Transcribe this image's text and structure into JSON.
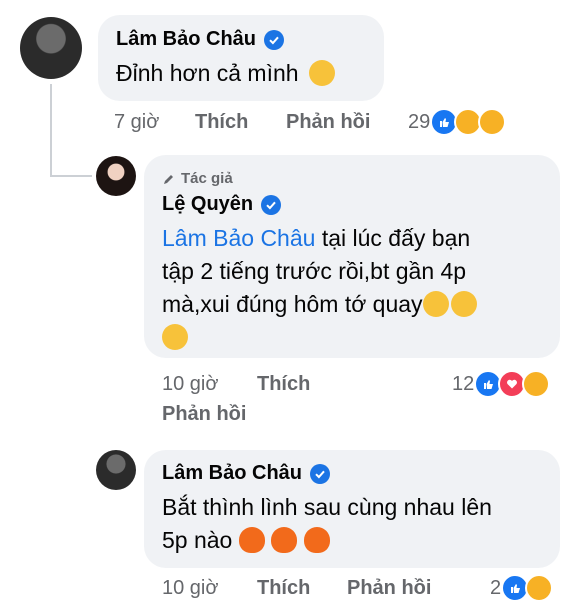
{
  "comments": [
    {
      "author": "Lâm Bảo Châu",
      "text": "Đỉnh hơn cả mình",
      "time": "7 giờ",
      "like_label": "Thích",
      "reply_label": "Phản hồi",
      "reaction_count": "29",
      "reactions": [
        "like-icon",
        "haha-icon",
        "care-icon"
      ]
    },
    {
      "author_tag": "Tác giả",
      "author": "Lệ Quyên",
      "mention": "Lâm Bảo Châu",
      "text_line1": " tại lúc đấy bạn",
      "text_line2": "tập 2 tiếng trước rồi,bt gần 4p",
      "text_line3": "mà,xui đúng hôm tớ quay",
      "time": "10 giờ",
      "like_label": "Thích",
      "reply_label": "Phản hồi",
      "reaction_count": "12",
      "reactions": [
        "like-icon",
        "love-icon",
        "haha-icon"
      ]
    },
    {
      "author": "Lâm Bảo Châu",
      "text_line1": "Bắt thình lình sau cùng nhau lên",
      "text_line2": "5p nào",
      "time": "10 giờ",
      "like_label": "Thích",
      "reply_label": "Phản hồi",
      "reaction_count": "2",
      "reactions": [
        "like-icon",
        "care-icon"
      ]
    }
  ],
  "colors": {
    "accent": "#1b74e4",
    "bubble": "#f0f2f5",
    "muted": "#65676b"
  }
}
